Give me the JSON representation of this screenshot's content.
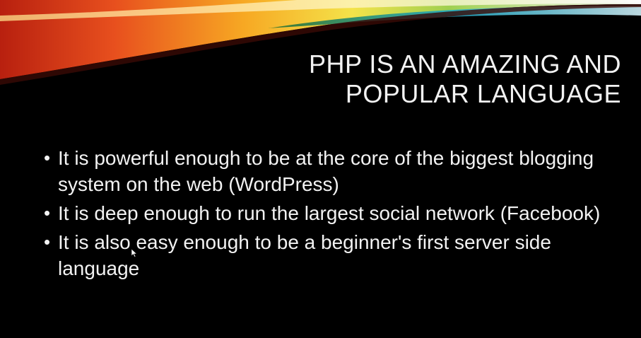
{
  "slide": {
    "title_lines": [
      "PHP IS AN AMAZING AND",
      "POPULAR LANGUAGE"
    ],
    "bullet_symbol": "•",
    "bullets": [
      "It is powerful enough to be at the core of the biggest blogging system on the web (WordPress)",
      "It is deep enough to run the largest social network (Facebook)",
      "It is also easy enough to be a beginner's first server side language"
    ]
  },
  "theme": {
    "background": "#000000",
    "text_color": "#f2f2f2",
    "accent_colors": [
      "#e8501e",
      "#f7a823",
      "#f4e34a",
      "#7cc242",
      "#1fa9c6"
    ]
  },
  "icons": {
    "pointer": "mouse-pointer-icon"
  }
}
